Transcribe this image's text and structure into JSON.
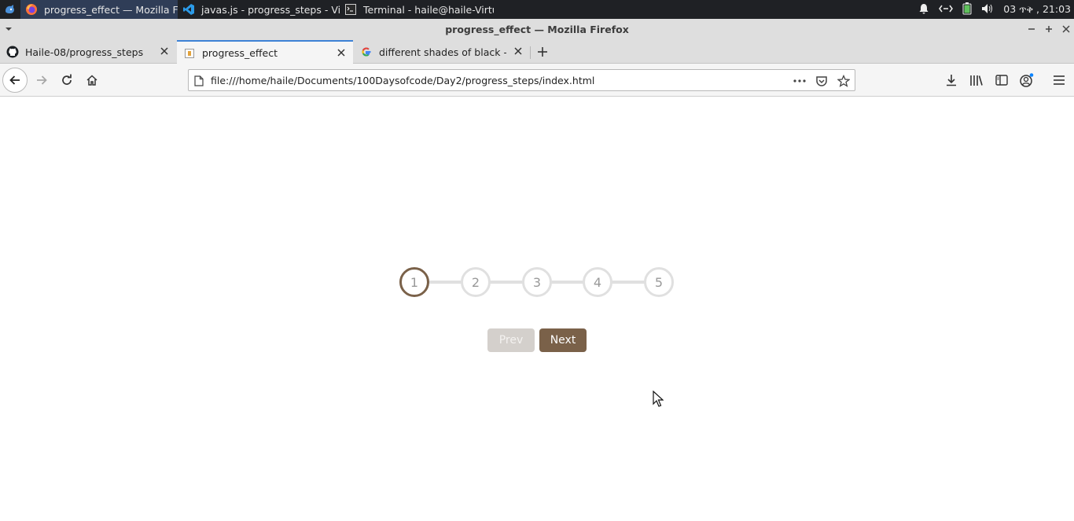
{
  "taskbar": {
    "tasks": [
      {
        "label": "progress_effect — Mozilla Fi..."
      },
      {
        "label": "javas.js - progress_steps - Vi..."
      },
      {
        "label": "Terminal - haile@haile-Virtu..."
      }
    ],
    "clock": "03 ጥቅ , 21:03"
  },
  "window": {
    "title": "progress_effect — Mozilla Firefox"
  },
  "tabs": [
    {
      "label": "Haile-08/progress_steps"
    },
    {
      "label": "progress_effect"
    },
    {
      "label": "different shades of black - Go"
    }
  ],
  "navbar": {
    "url": "file:///home/haile/Documents/100Daysofcode/Day2/progress_steps/index.html"
  },
  "page": {
    "steps": [
      "1",
      "2",
      "3",
      "4",
      "5"
    ],
    "active_step": 1,
    "prev_label": "Prev",
    "next_label": "Next",
    "accent_color": "#7a6149",
    "inactive_color": "#e0e0e0"
  }
}
